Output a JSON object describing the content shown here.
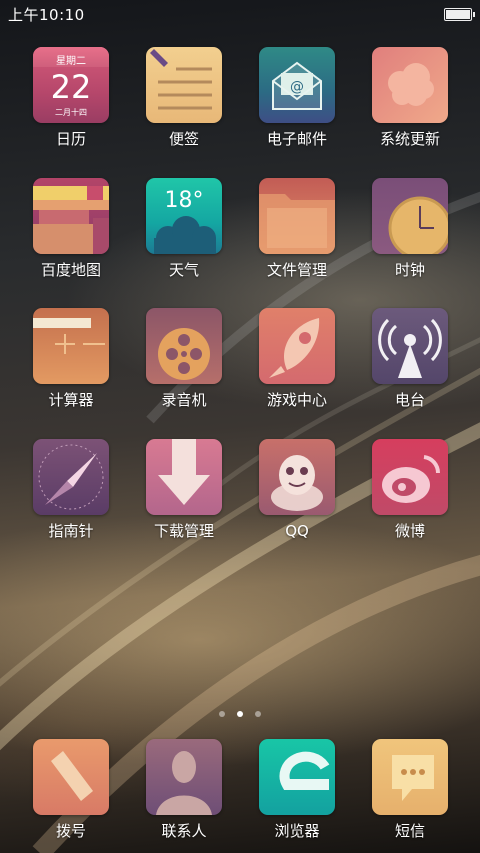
{
  "status": {
    "time": "上午10:10"
  },
  "pager": {
    "current": 2,
    "total": 3
  },
  "calendar": {
    "weekday": "星期二",
    "day": "22",
    "lunar": "二月十四"
  },
  "weather": {
    "temp": "18°"
  },
  "apps": [
    {
      "id": "calendar",
      "label": "日历",
      "icon": "calendar-icon"
    },
    {
      "id": "notes",
      "label": "便签",
      "icon": "notes-icon"
    },
    {
      "id": "email",
      "label": "电子邮件",
      "icon": "email-icon"
    },
    {
      "id": "update",
      "label": "系统更新",
      "icon": "cloud-update-icon"
    },
    {
      "id": "map",
      "label": "百度地图",
      "icon": "map-icon"
    },
    {
      "id": "weather",
      "label": "天气",
      "icon": "weather-icon"
    },
    {
      "id": "files",
      "label": "文件管理",
      "icon": "folder-icon"
    },
    {
      "id": "clock",
      "label": "时钟",
      "icon": "clock-icon"
    },
    {
      "id": "calculator",
      "label": "计算器",
      "icon": "calculator-icon"
    },
    {
      "id": "recorder",
      "label": "录音机",
      "icon": "film-reel-icon"
    },
    {
      "id": "games",
      "label": "游戏中心",
      "icon": "rocket-icon"
    },
    {
      "id": "radio",
      "label": "电台",
      "icon": "radio-tower-icon"
    },
    {
      "id": "compass",
      "label": "指南针",
      "icon": "compass-icon"
    },
    {
      "id": "download",
      "label": "下载管理",
      "icon": "download-arrow-icon"
    },
    {
      "id": "qq",
      "label": "QQ",
      "icon": "qq-penguin-icon"
    },
    {
      "id": "weibo",
      "label": "微博",
      "icon": "weibo-icon"
    }
  ],
  "dock": [
    {
      "id": "dialer",
      "label": "拨号",
      "icon": "phone-icon"
    },
    {
      "id": "contacts",
      "label": "联系人",
      "icon": "contact-person-icon"
    },
    {
      "id": "browser",
      "label": "浏览器",
      "icon": "browser-e-icon"
    },
    {
      "id": "sms",
      "label": "短信",
      "icon": "message-bubble-icon"
    }
  ]
}
